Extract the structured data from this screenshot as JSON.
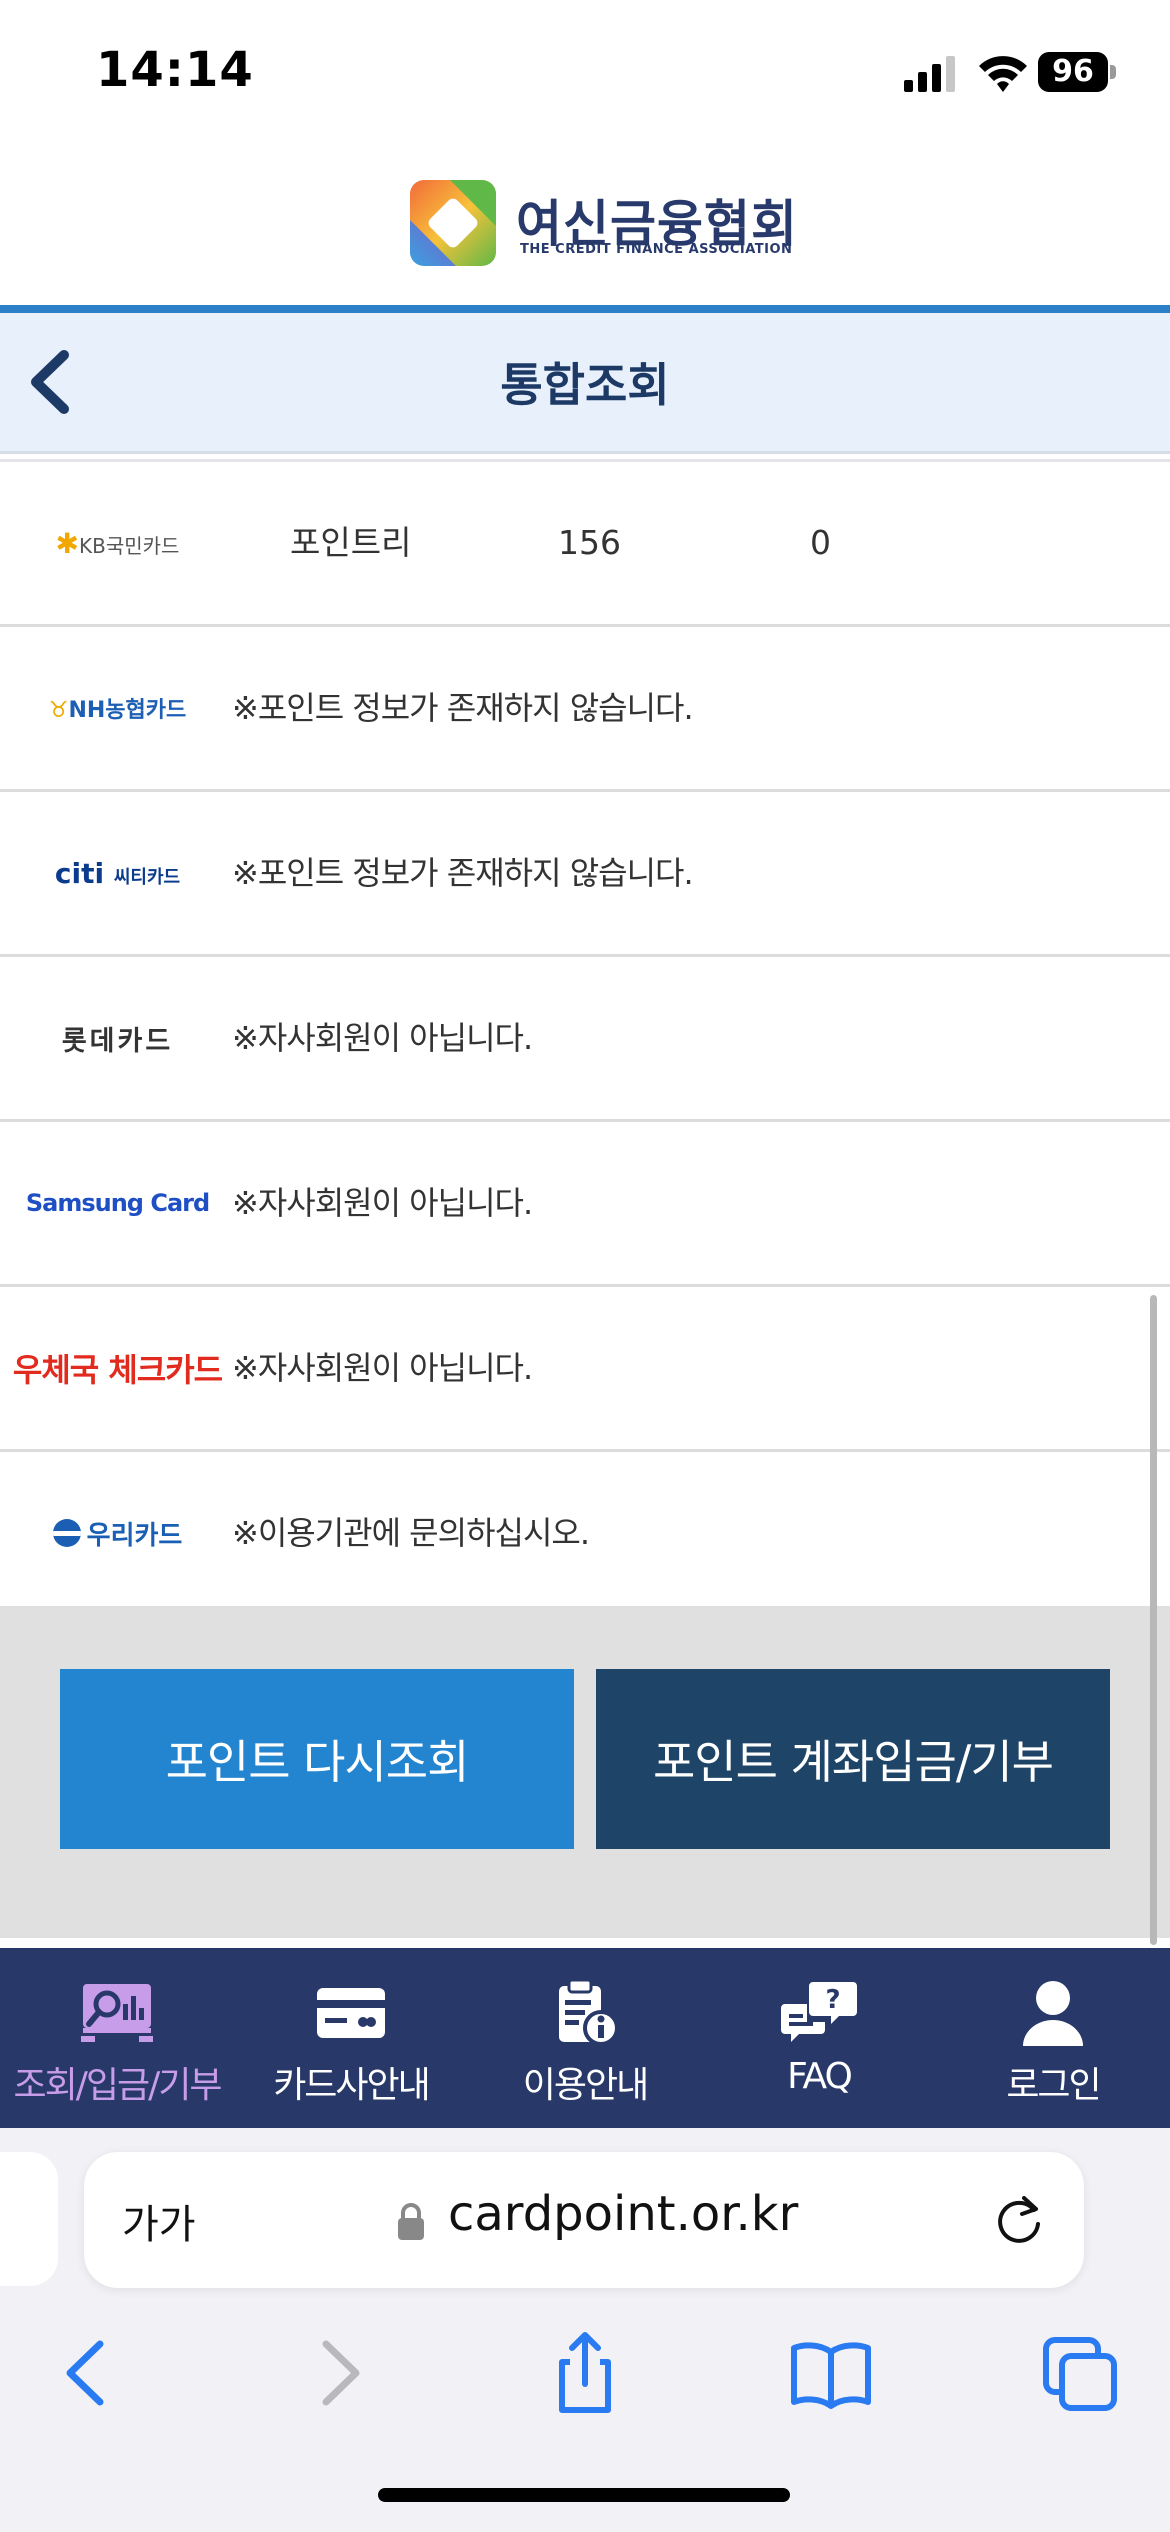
{
  "status_bar": {
    "time": "14:14",
    "battery": "96"
  },
  "header": {
    "org_name_ko": "여신금융협회",
    "org_name_en": "THE CREDIT FINANCE ASSOCIATION",
    "title": "통합조회"
  },
  "rows": [
    {
      "card": "KB국민카드",
      "point_name": "포인트리",
      "points": "156",
      "other": "0"
    },
    {
      "card": "NH농협카드",
      "message": "※포인트 정보가 존재하지 않습니다."
    },
    {
      "card_brand": "citi",
      "card": "씨티카드",
      "message": "※포인트 정보가 존재하지 않습니다."
    },
    {
      "card": "롯데카드",
      "message": "※자사회원이 아닙니다."
    },
    {
      "card": "Samsung Card",
      "message": "※자사회원이 아닙니다."
    },
    {
      "card": "우체국 체크카드",
      "message": "※자사회원이 아닙니다."
    },
    {
      "card": "우리카드",
      "message": "※이용기관에 문의하십시오."
    }
  ],
  "buttons": {
    "requery": "포인트 다시조회",
    "deposit": "포인트 계좌입금/기부"
  },
  "nav": [
    {
      "label": "조회/입금/기부",
      "icon": "search-chart-icon",
      "active": true
    },
    {
      "label": "카드사안내",
      "icon": "credit-card-icon"
    },
    {
      "label": "이용안내",
      "icon": "clipboard-info-icon"
    },
    {
      "label": "FAQ",
      "icon": "faq-chat-icon"
    },
    {
      "label": "로그인",
      "icon": "user-icon"
    }
  ],
  "browser": {
    "text_size_label": "가가",
    "url": "cardpoint.or.kr"
  },
  "colors": {
    "accent_blue": "#2384cf",
    "dark_navy": "#1e4467",
    "nav_bg": "#283868",
    "nav_active": "#c79dea",
    "title_text": "#1d3a66"
  }
}
